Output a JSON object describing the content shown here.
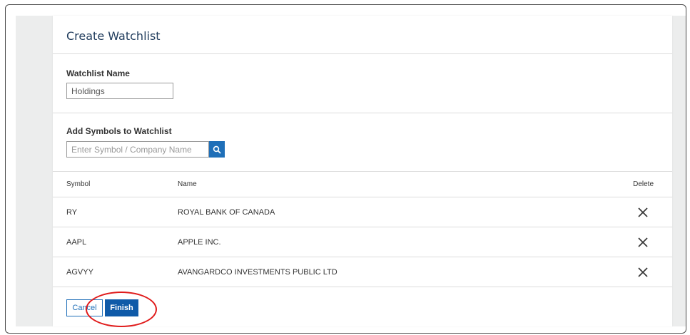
{
  "dialog": {
    "title": "Create Watchlist"
  },
  "watchlist_name": {
    "label": "Watchlist Name",
    "value": "Holdings"
  },
  "add_symbols": {
    "label": "Add Symbols to Watchlist",
    "placeholder": "Enter Symbol / Company Name",
    "search_icon": "search-icon"
  },
  "table": {
    "headers": {
      "symbol": "Symbol",
      "name": "Name",
      "delete": "Delete"
    },
    "rows": [
      {
        "symbol": "RY",
        "name": "ROYAL BANK OF CANADA"
      },
      {
        "symbol": "AAPL",
        "name": "APPLE INC."
      },
      {
        "symbol": "AGVYY",
        "name": "AVANGARDCO INVESTMENTS PUBLIC LTD"
      }
    ],
    "delete_icon": "close-icon"
  },
  "actions": {
    "cancel_label": "Cancel",
    "finish_label": "Finish"
  },
  "colors": {
    "primary": "#0f5aa8",
    "title": "#1f3b5c",
    "highlight_ring": "#e01b1b",
    "backdrop": "#eceded"
  }
}
